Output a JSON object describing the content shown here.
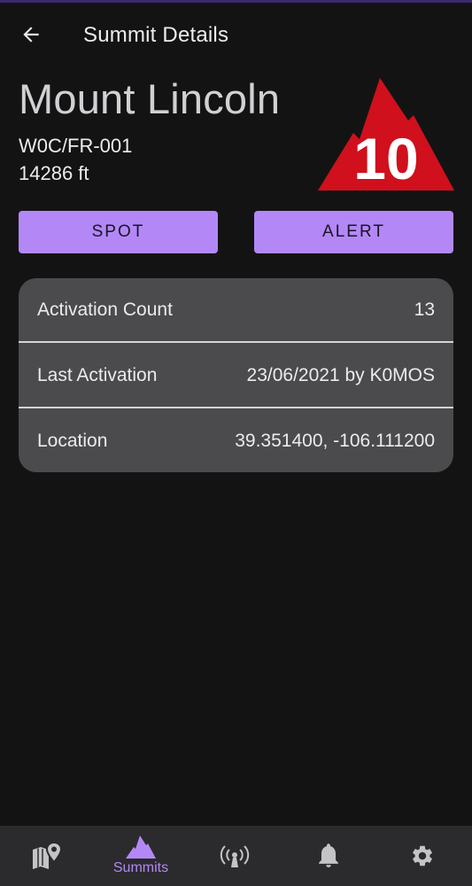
{
  "app_bar": {
    "title": "Summit Details",
    "back_icon": "arrow-back-icon"
  },
  "summit": {
    "name": "Mount Lincoln",
    "code": "W0C/FR-001",
    "altitude": "14286 ft",
    "points": "10",
    "badge_color": "#d0101c"
  },
  "actions": {
    "spot_label": "SPOT",
    "alert_label": "ALERT",
    "accent_color": "#b388f6"
  },
  "details": [
    {
      "label": "Activation Count",
      "value": "13"
    },
    {
      "label": "Last Activation",
      "value": "23/06/2021 by K0MOS"
    },
    {
      "label": "Location",
      "value": "39.351400, -106.111200"
    }
  ],
  "bottom_nav": {
    "items": [
      {
        "icon": "map-pin-icon",
        "label": ""
      },
      {
        "icon": "mountain-icon",
        "label": "Summits",
        "active": true
      },
      {
        "icon": "radio-tower-icon",
        "label": ""
      },
      {
        "icon": "bell-icon",
        "label": ""
      },
      {
        "icon": "gear-icon",
        "label": ""
      }
    ]
  }
}
